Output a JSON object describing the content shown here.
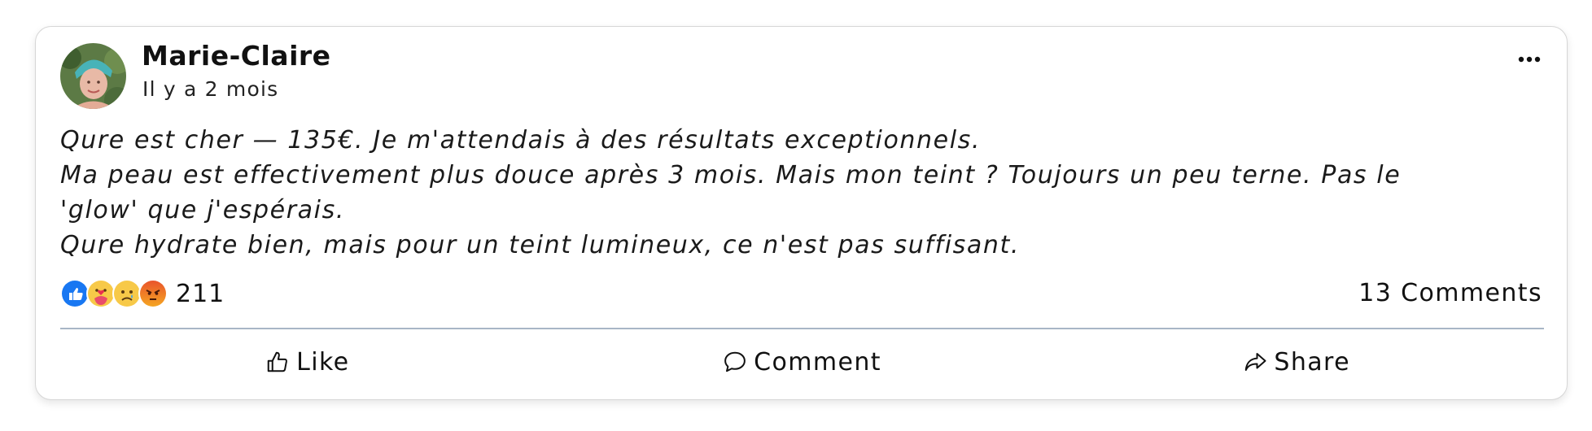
{
  "post": {
    "author": "Marie-Claire",
    "timestamp": "Il y a 2 mois",
    "more_icon": "ellipsis-icon",
    "lines": [
      "Qure est cher — 135€. Je m'attendais à des résultats exceptionnels.",
      "Ma peau est effectivement plus douce après 3 mois. Mais mon teint ? Toujours un peu terne. Pas le",
      "'glow' que j'espérais.",
      "Qure hydrate bien, mais pour un teint lumineux, ce n'est pas suffisant."
    ]
  },
  "stats": {
    "reactions": [
      "like-reaction-icon",
      "care-reaction-icon",
      "sad-reaction-icon",
      "angry-reaction-icon"
    ],
    "reaction_count": "211",
    "comments": "13 Comments"
  },
  "actions": {
    "like": "Like",
    "comment": "Comment",
    "share": "Share"
  },
  "colors": {
    "like_blue": "#1877f2",
    "divider": "#a8b6c6",
    "reaction_yellow": "#f7c948",
    "angry_orange": "#e9542b"
  }
}
